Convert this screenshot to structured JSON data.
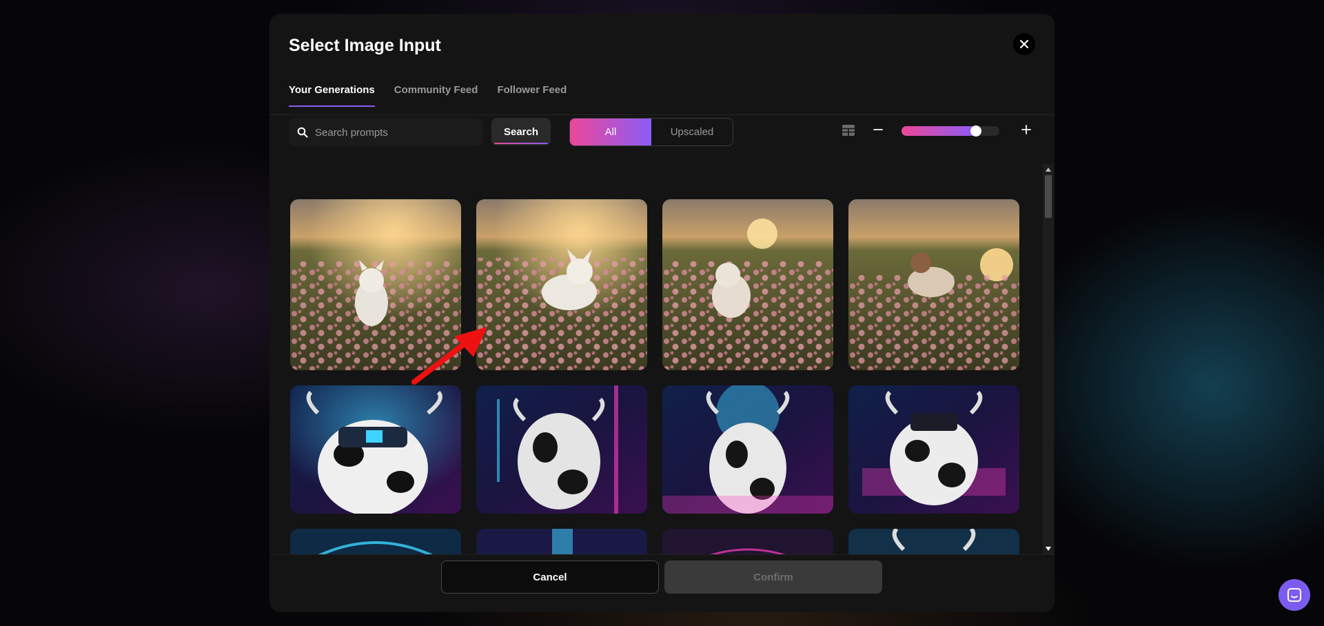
{
  "modal": {
    "title": "Select Image Input",
    "tabs": [
      {
        "label": "Your Generations",
        "active": true
      },
      {
        "label": "Community Feed",
        "active": false
      },
      {
        "label": "Follower Feed",
        "active": false
      }
    ]
  },
  "toolbar": {
    "search_placeholder": "Search prompts",
    "search_value": "",
    "search_button_label": "Search",
    "filter": {
      "options": [
        "All",
        "Upscaled"
      ],
      "selected": "All"
    },
    "size_slider_level": 0.76,
    "icons": {
      "search": "search-icon",
      "layout": "grid-layout-icon",
      "minus": "minus-icon",
      "plus": "plus-icon",
      "close": "close-icon"
    }
  },
  "gallery": {
    "rows": [
      {
        "theme": "dog-flower-field-sunset",
        "items": [
          "dog-running-flowers-1",
          "dog-running-flowers-2",
          "dog-running-flowers-3",
          "dog-running-flowers-4"
        ]
      },
      {
        "theme": "cyberpunk-cow",
        "items": [
          "cyber-cow-1",
          "cyber-cow-2",
          "cyber-cow-3",
          "cyber-cow-4"
        ]
      },
      {
        "theme": "cyberpunk-cow-partial",
        "items": [
          "cyber-cow-5",
          "cyber-cow-6",
          "cyber-cow-7",
          "cyber-cow-8"
        ]
      }
    ]
  },
  "footer": {
    "cancel_label": "Cancel",
    "confirm_label": "Confirm",
    "confirm_enabled": false
  },
  "colors": {
    "accent_pink": "#ec4899",
    "accent_purple": "#8b5cf6",
    "modal_bg": "#141414",
    "chat_bubble": "#7c5cf0",
    "annotation_arrow": "#ee1111"
  },
  "widgets": {
    "chat_icon": "chat-icon"
  }
}
